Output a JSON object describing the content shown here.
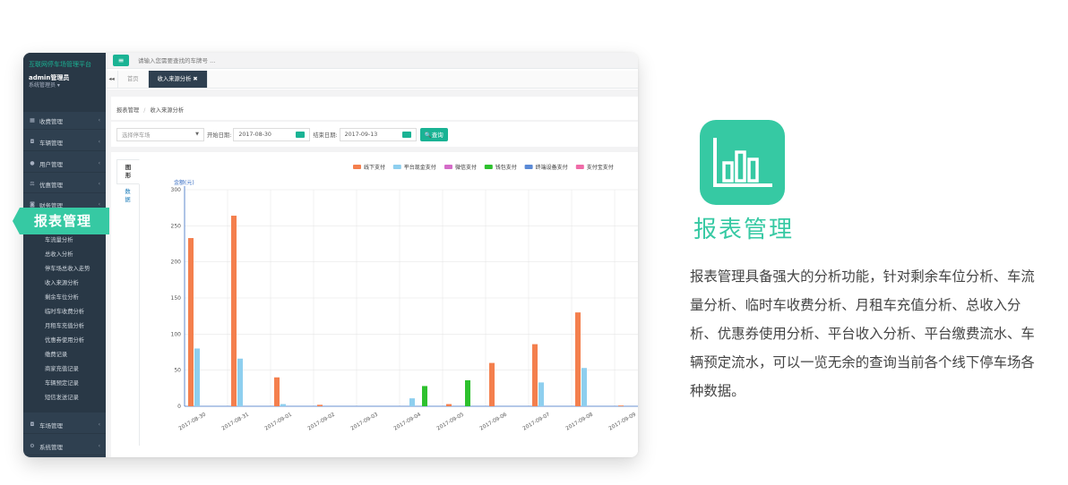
{
  "app": {
    "title": "互联网停车场管理平台",
    "user": "admin管理员",
    "role": "系统管理员 ▾"
  },
  "sidebar": {
    "items": [
      {
        "label": "收费管理",
        "icon": "grid-icon"
      },
      {
        "label": "车辆管理",
        "icon": "car-icon"
      },
      {
        "label": "用户管理",
        "icon": "user-icon"
      },
      {
        "label": "优惠管理",
        "icon": "coupon-icon"
      },
      {
        "label": "财务管理",
        "icon": "finance-icon"
      }
    ],
    "report_submenu": [
      "车流量分析",
      "总收入分析",
      "停车场总收入走势",
      "收入来源分析",
      "剩余车位分析",
      "临时车收费分析",
      "月租车充值分析",
      "优惠券使用分析",
      "缴费记录",
      "商家充值记录",
      "车辆预定记录",
      "短信发送记录"
    ],
    "bottom_items": [
      {
        "label": "车场管理",
        "icon": "car-icon"
      },
      {
        "label": "系统管理",
        "icon": "gears-icon"
      }
    ]
  },
  "topbar": {
    "search_placeholder": "请输入您需要查找的车牌号 ..."
  },
  "tabs": {
    "back": "◂◂",
    "home": "首页",
    "active": "收入来源分析 ✖"
  },
  "breadcrumb": {
    "root": "报表管理",
    "sep": "/",
    "current": "收入来源分析"
  },
  "filters": {
    "parking_placeholder": "选择停车场",
    "start_label": "开始日期:",
    "start_value": "2017-08-30",
    "end_label": "结束日期:",
    "end_value": "2017-09-13",
    "query_label": "🔍查询"
  },
  "chart_tabs": {
    "graph": "图\n形",
    "data": "数\n据"
  },
  "ribbon": {
    "label": "报表管理"
  },
  "right": {
    "title": "报表管理",
    "description": "报表管理具备强大的分析功能，针对剩余车位分析、车流量分析、临时车收费分析、月租车充值分析、总收入分析、优惠券使用分析、平台收入分析、平台缴费流水、车辆预定流水，可以一览无余的查询当前各个线下停车场各种数据。"
  },
  "colors": {
    "accent": "#1ab394",
    "ribbon": "#36c9a3",
    "sidebar": "#2f4050"
  },
  "chart_data": {
    "type": "bar",
    "ylabel": "金额(元)",
    "ylim": [
      0,
      300
    ],
    "yticks": [
      0,
      50,
      100,
      150,
      200,
      250,
      300
    ],
    "grid": true,
    "legend_position": "top-right",
    "categories": [
      "2017-08-30",
      "2017-08-31",
      "2017-09-01",
      "2017-09-02",
      "2017-09-03",
      "2017-09-04",
      "2017-09-05",
      "2017-09-06",
      "2017-09-07",
      "2017-09-08",
      "2017-09-09"
    ],
    "series": [
      {
        "name": "线下支付",
        "color": "#f47f4d",
        "values": [
          233,
          264,
          40,
          2,
          0,
          0,
          3,
          60,
          86,
          130,
          1
        ]
      },
      {
        "name": "平台现金支付",
        "color": "#8ecfef",
        "values": [
          80,
          66,
          3,
          0,
          0,
          11,
          0,
          0,
          33,
          53,
          0
        ]
      },
      {
        "name": "微信支付",
        "color": "#d46cc8",
        "values": [
          0,
          0,
          0,
          0,
          0,
          0,
          0,
          0,
          0,
          0,
          0
        ]
      },
      {
        "name": "钱包支付",
        "color": "#2ec12e",
        "values": [
          0,
          0,
          0,
          0,
          0,
          28,
          36,
          0,
          0,
          0,
          0
        ]
      },
      {
        "name": "终端设备支付",
        "color": "#5b8ad6",
        "values": [
          0,
          0,
          0,
          0,
          0,
          0,
          0,
          0,
          0,
          0,
          0
        ]
      },
      {
        "name": "支付宝支付",
        "color": "#f06ba8",
        "values": [
          0,
          0,
          0,
          0,
          0,
          0,
          0,
          0,
          0,
          0,
          0
        ]
      }
    ]
  }
}
